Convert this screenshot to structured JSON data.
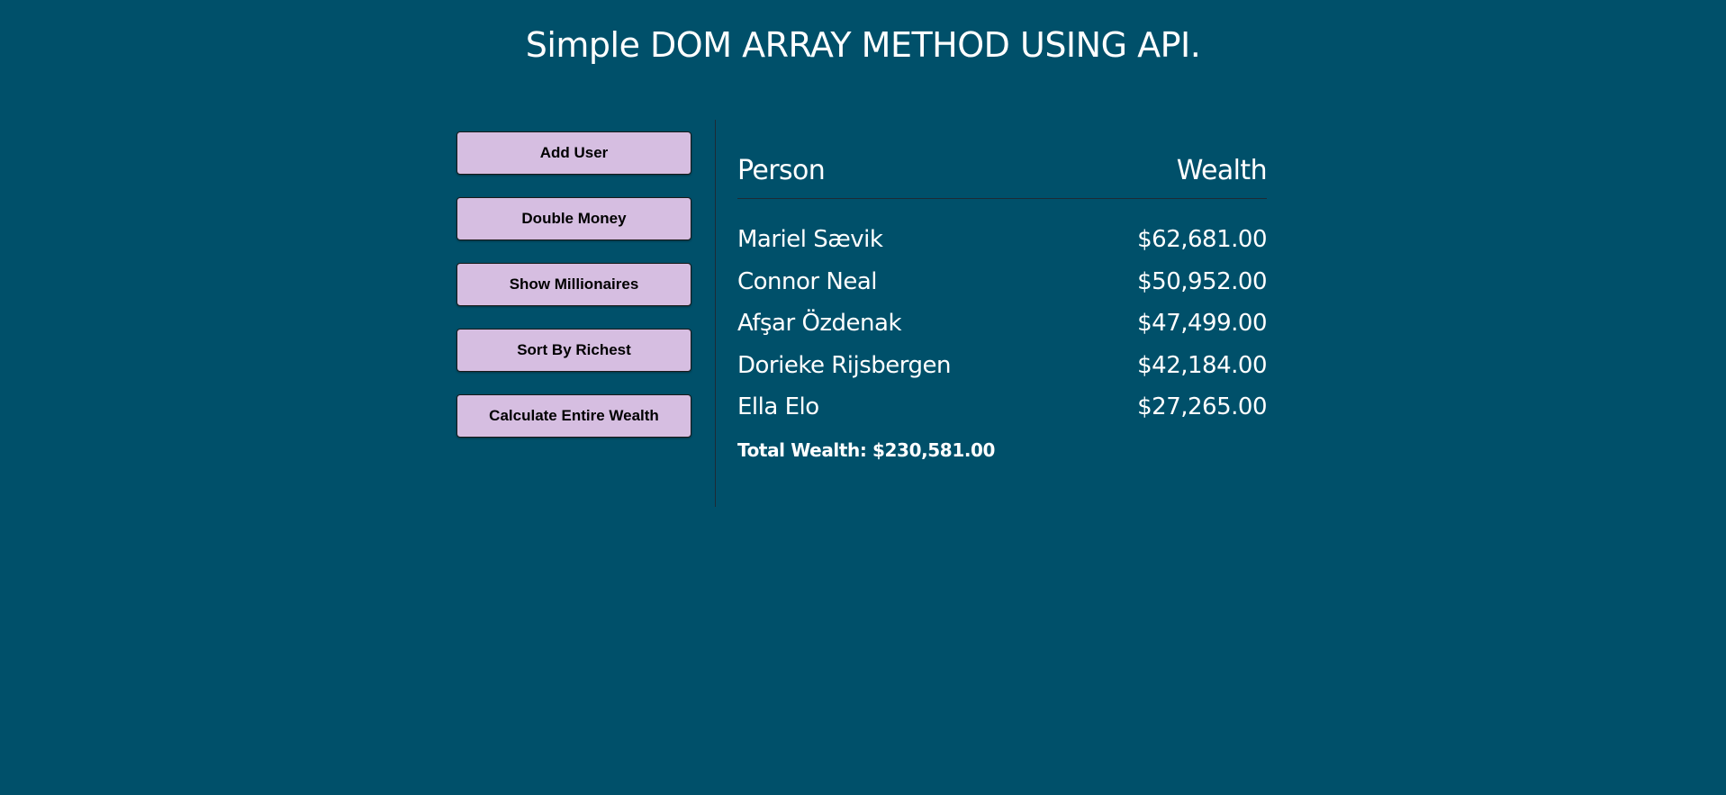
{
  "page": {
    "title": "Simple DOM ARRAY METHOD USING API.",
    "background_color": "#00506a",
    "button_color": "#d6bee1"
  },
  "actions": {
    "add_user": "Add User",
    "double_money": "Double Money",
    "show_millionaires": "Show Millionaires",
    "sort_by_richest": "Sort By Richest",
    "calculate_entire_wealth": "Calculate Entire Wealth"
  },
  "table": {
    "headers": {
      "person": "Person",
      "wealth": "Wealth"
    },
    "rows": [
      {
        "name": "Mariel Sævik",
        "wealth": "$62,681.00"
      },
      {
        "name": "Connor Neal",
        "wealth": "$50,952.00"
      },
      {
        "name": "Afşar Özdenak",
        "wealth": "$47,499.00"
      },
      {
        "name": "Dorieke Rijsbergen",
        "wealth": "$42,184.00"
      },
      {
        "name": "Ella Elo",
        "wealth": "$27,265.00"
      }
    ],
    "total": "Total Wealth: $230,581.00"
  }
}
